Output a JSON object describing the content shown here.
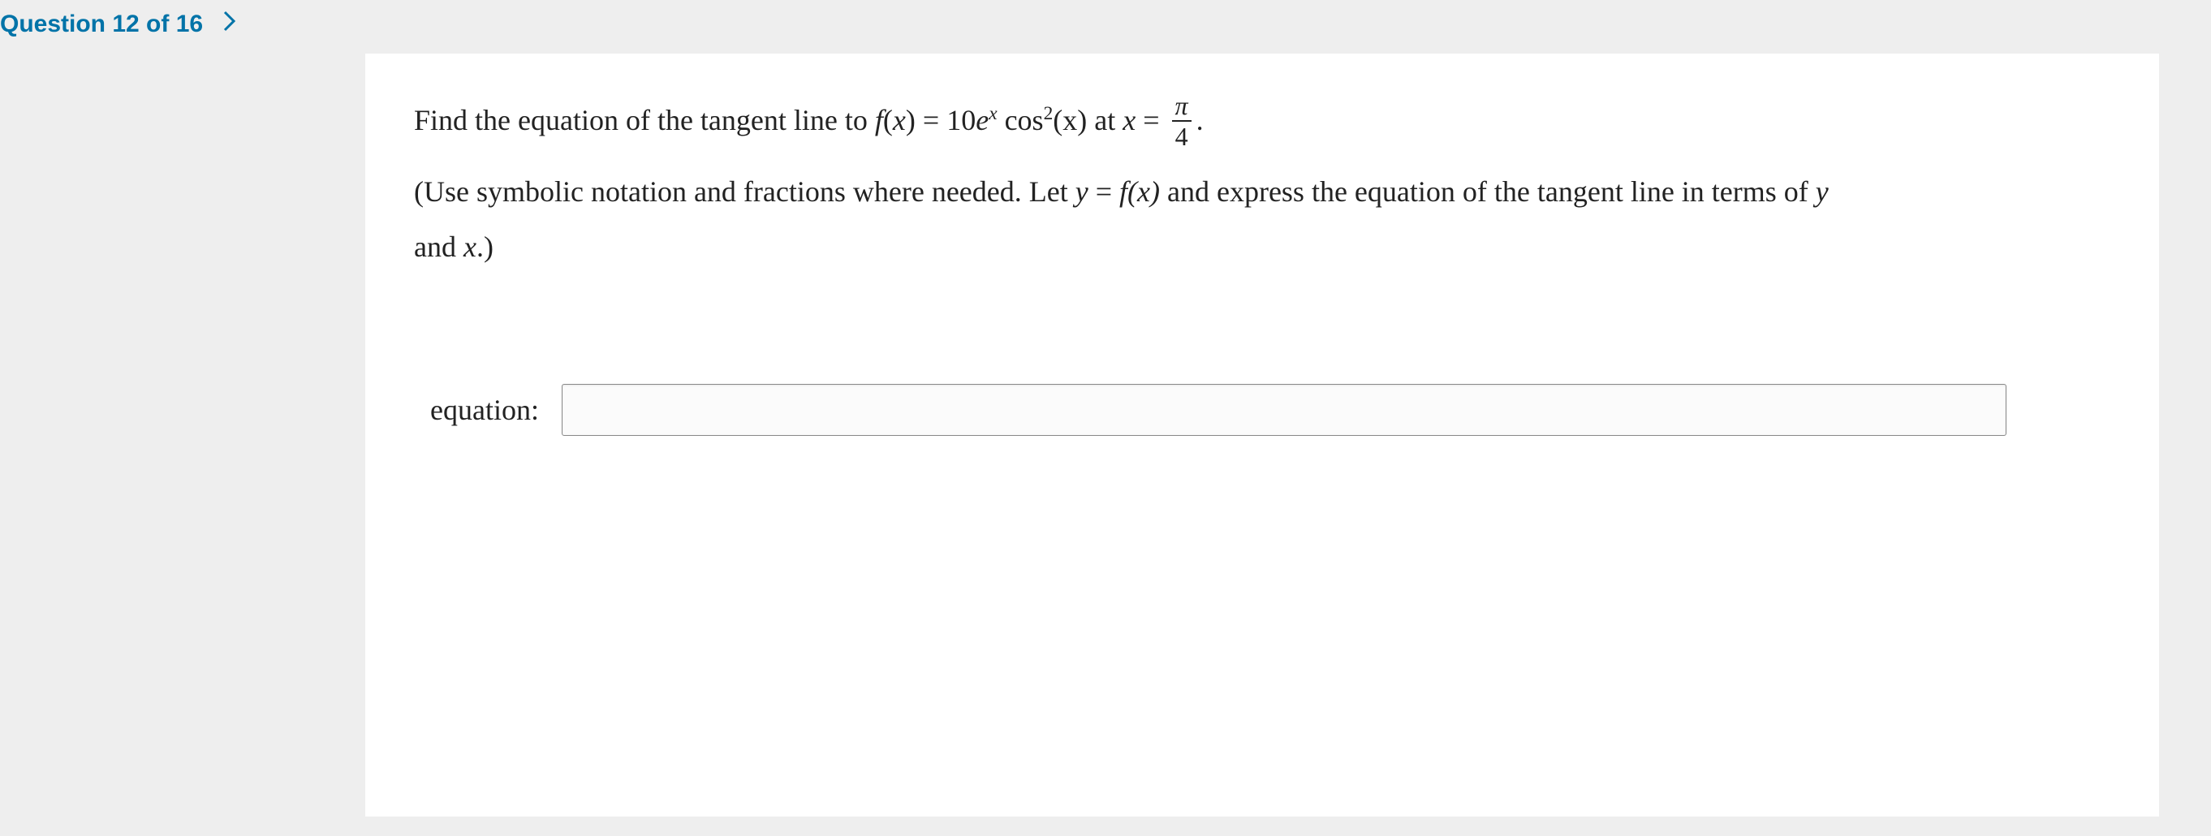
{
  "header": {
    "question_label": "Question 12 of 16"
  },
  "problem": {
    "prefix": "Find the equation of the tangent line to ",
    "func_name": "f",
    "func_arg": "x",
    "equals": " = ",
    "coeff": "10",
    "e": "e",
    "exp": "x",
    "trig": " cos",
    "trigexp": "2",
    "trigarg": "(x)",
    "at": " at ",
    "xeq": "x = ",
    "frac_num": "π",
    "frac_den": "4",
    "period": ".",
    "hint1": "(Use symbolic notation and fractions where needed. Let ",
    "hint_y": "y",
    "hint_eq": " = ",
    "hint_fx": "f(x)",
    "hint2": " and express the equation of the tangent line in terms of ",
    "hint_y2": "y",
    "hint3": "and ",
    "hint_x2": "x",
    "hint4": ".)"
  },
  "answer": {
    "label": "equation:",
    "value": ""
  }
}
